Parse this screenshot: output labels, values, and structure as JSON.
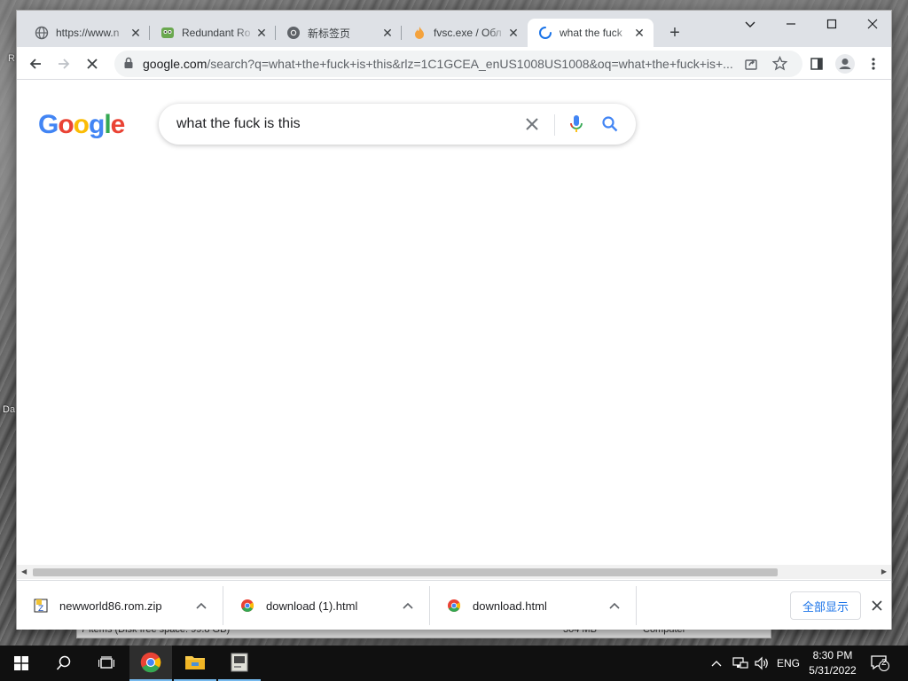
{
  "desktop": {
    "labels": [
      "R",
      "Da"
    ]
  },
  "behind_window": {
    "status_left": "7 items (Disk free space: 99.8 GB)",
    "status_size": "304 MB",
    "status_location": "Computer"
  },
  "tabs": [
    {
      "title": "https://www.n",
      "icon": "globe-icon",
      "active": false
    },
    {
      "title": "Redundant Ro",
      "icon": "app-icon",
      "active": false
    },
    {
      "title": "新标签页",
      "icon": "chrome-icon",
      "active": false
    },
    {
      "title": "fvsc.exe / Обл",
      "icon": "fire-icon",
      "active": false
    },
    {
      "title": "what the fuck",
      "icon": "loading-spinner-icon",
      "active": true
    }
  ],
  "address_bar": {
    "domain": "google.com",
    "path": "/search?q=what+the+fuck+is+this&rlz=1C1GCEA_enUS1008US1008&oq=what+the+fuck+is+..."
  },
  "search": {
    "logo": "Google",
    "query": "what the fuck is this"
  },
  "downloads": {
    "items": [
      {
        "name": "newworld86.rom.zip",
        "icon": "zip-file-icon"
      },
      {
        "name": "download (1).html",
        "icon": "chrome-file-icon"
      },
      {
        "name": "download.html",
        "icon": "chrome-file-icon"
      }
    ],
    "show_all_label": "全部显示"
  },
  "taskbar": {
    "language": "ENG",
    "time": "8:30 PM",
    "date": "5/31/2022",
    "notification_count": "2"
  },
  "colors": {
    "google_blue": "#4285F4",
    "google_red": "#EA4335",
    "google_yellow": "#FBBC05",
    "google_green": "#34A853",
    "link_blue": "#1a73e8"
  }
}
